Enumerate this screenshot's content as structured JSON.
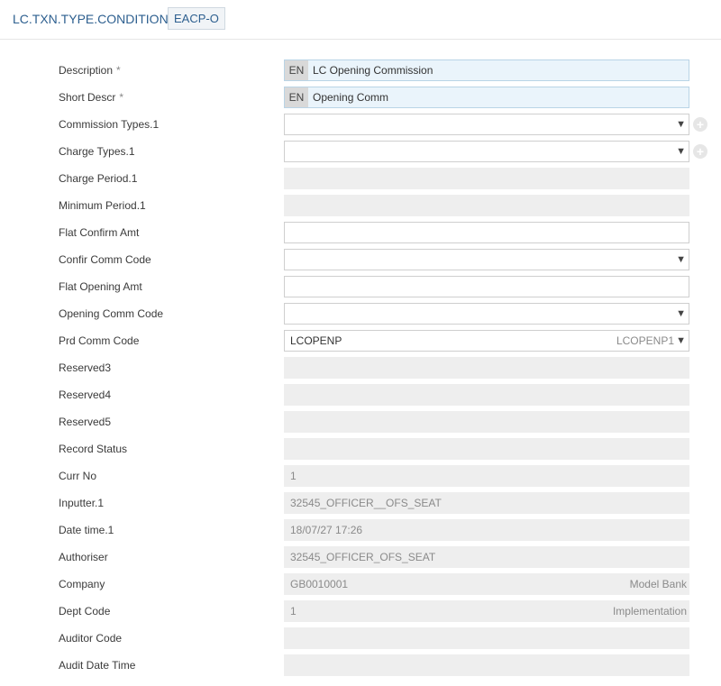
{
  "header": {
    "title": "LC.TXN.TYPE.CONDITION",
    "badge": "EACP-O"
  },
  "fields": {
    "description": {
      "label": "Description",
      "required": "*",
      "lang": "EN",
      "value": "LC Opening Commission"
    },
    "short_descr": {
      "label": "Short Descr",
      "required": "*",
      "lang": "EN",
      "value": "Opening Comm"
    },
    "commission_types": {
      "label": "Commission Types.1",
      "value": ""
    },
    "charge_types": {
      "label": "Charge Types.1",
      "value": ""
    },
    "charge_period": {
      "label": "Charge Period.1",
      "value": ""
    },
    "minimum_period": {
      "label": "Minimum Period.1",
      "value": ""
    },
    "flat_confirm_amt": {
      "label": "Flat Confirm Amt",
      "value": ""
    },
    "confir_comm_code": {
      "label": "Confir Comm Code",
      "value": ""
    },
    "flat_opening_amt": {
      "label": "Flat Opening Amt",
      "value": ""
    },
    "opening_comm_code": {
      "label": "Opening Comm Code",
      "value": ""
    },
    "prd_comm_code": {
      "label": "Prd Comm Code",
      "value": "LCOPENP",
      "desc": "LCOPENP1"
    },
    "reserved3": {
      "label": "Reserved3",
      "value": ""
    },
    "reserved4": {
      "label": "Reserved4",
      "value": ""
    },
    "reserved5": {
      "label": "Reserved5",
      "value": ""
    },
    "record_status": {
      "label": "Record Status",
      "value": ""
    },
    "curr_no": {
      "label": "Curr No",
      "value": "1"
    },
    "inputter": {
      "label": "Inputter.1",
      "value": "32545_OFFICER__OFS_SEAT"
    },
    "date_time": {
      "label": "Date time.1",
      "value": "18/07/27 17:26"
    },
    "authoriser": {
      "label": "Authoriser",
      "value": "32545_OFFICER_OFS_SEAT"
    },
    "company": {
      "label": "Company",
      "value": "GB0010001",
      "desc": "Model Bank"
    },
    "dept_code": {
      "label": "Dept Code",
      "value": "1",
      "desc": "Implementation"
    },
    "auditor_code": {
      "label": "Auditor Code",
      "value": ""
    },
    "audit_date_time": {
      "label": "Audit Date Time",
      "value": ""
    }
  },
  "icons": {
    "dropdown": "▼",
    "add": "+"
  }
}
